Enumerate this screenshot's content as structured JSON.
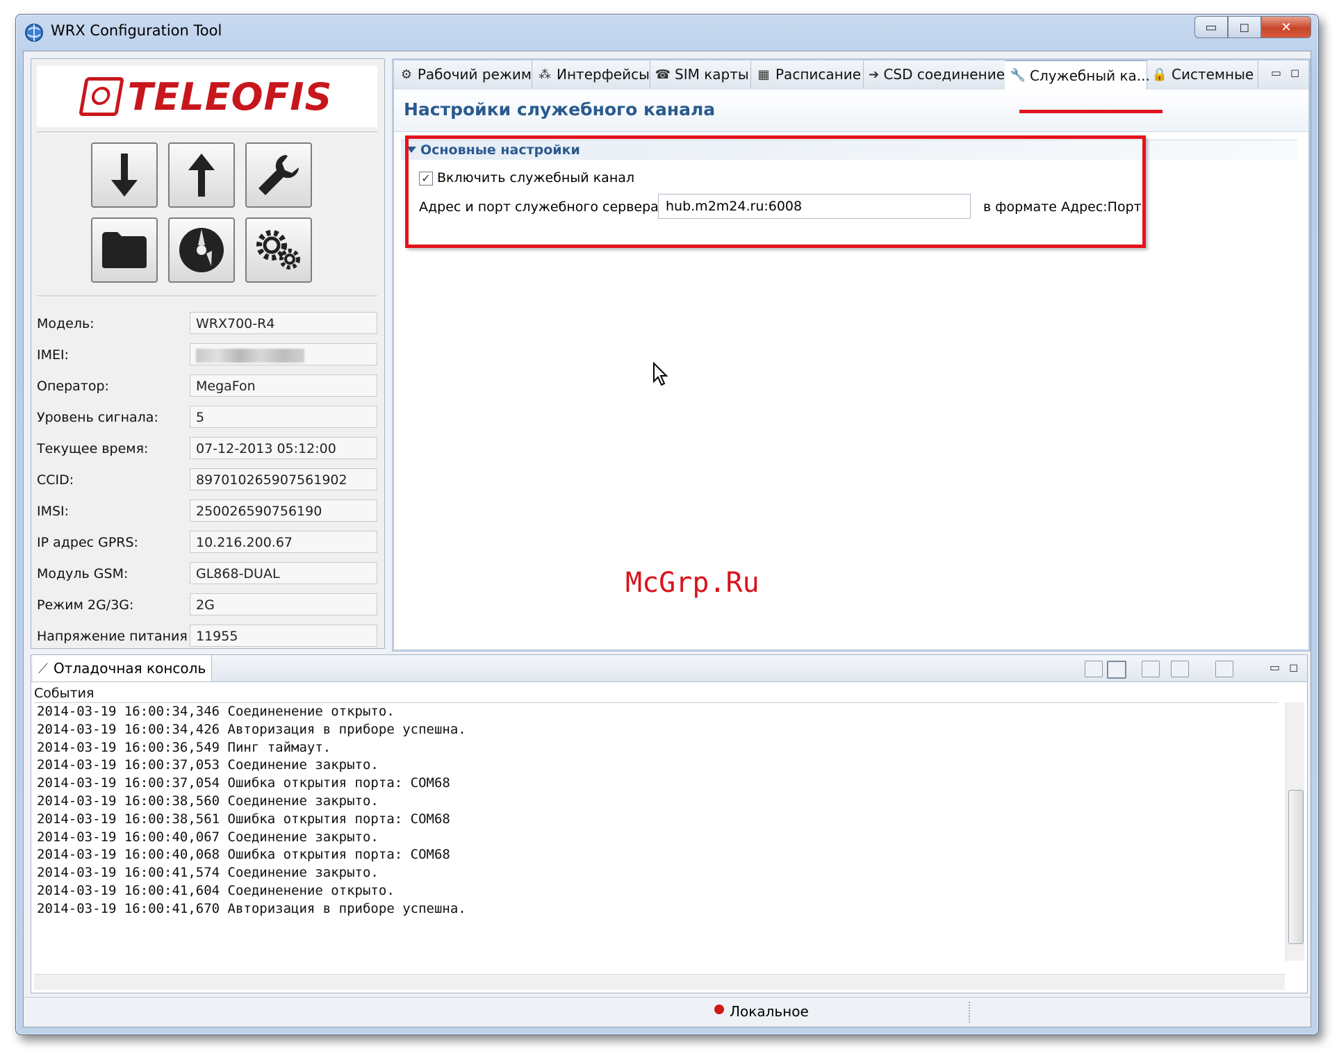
{
  "window": {
    "title": "WRX Configuration Tool",
    "controls": {
      "minimize": "▭",
      "maximize": "◻",
      "close": "✕"
    }
  },
  "left_panel": {
    "logo_text": "TELEOFIS",
    "toolbar_icons": [
      "arrow-down-icon",
      "arrow-up-icon",
      "wrench-icon",
      "folder-icon",
      "disc-icon",
      "gears-icon"
    ],
    "info": [
      {
        "label": "Модель:",
        "value": "WRX700-R4"
      },
      {
        "label": "IMEI:",
        "value": ""
      },
      {
        "label": "Оператор:",
        "value": "MegaFon"
      },
      {
        "label": "Уровень сигнала:",
        "value": "5"
      },
      {
        "label": "Текущее время:",
        "value": "07-12-2013 05:12:00"
      },
      {
        "label": "CCID:",
        "value": "897010265907561902"
      },
      {
        "label": "IMSI:",
        "value": "250026590756190"
      },
      {
        "label": "IP адрес GPRS:",
        "value": "10.216.200.67"
      },
      {
        "label": "Модуль GSM:",
        "value": "GL868-DUAL"
      },
      {
        "label": "Режим 2G/3G:",
        "value": "2G"
      },
      {
        "label": "Напряжение питания",
        "value": "11955"
      }
    ]
  },
  "editor": {
    "tabs": [
      {
        "label": "Рабочий режим",
        "icon": "gear-dot-icon"
      },
      {
        "label": "Интерфейсы",
        "icon": "interfaces-icon"
      },
      {
        "label": "SIM карты",
        "icon": "phone-icon"
      },
      {
        "label": "Расписание",
        "icon": "schedule-icon"
      },
      {
        "label": "CSD соединение",
        "icon": "arrow-right-icon"
      },
      {
        "label": "Служебный ка...",
        "icon": "wrench-icon"
      },
      {
        "label": "Системные",
        "icon": "lock-icon"
      }
    ],
    "active_tab": 5,
    "page_title": "Настройки служебного канала",
    "section_title": "Основные настройки",
    "enable_label": "Включить служебный канал",
    "enable_checked": true,
    "address_label": "Адрес и порт служебного сервера",
    "address_value": "hub.m2m24.ru:6008",
    "address_hint": "в формате Адрес:Порт",
    "highlight_color": "#e3141d"
  },
  "watermark": "McGrp.Ru",
  "console": {
    "tab_label": "Отладочная консоль",
    "events_label": "События",
    "lines": [
      "2014-03-19 16:00:34,346 Соединенение открыто.",
      "2014-03-19 16:00:34,426 Авторизация в приборе успешна.",
      "2014-03-19 16:00:36,549 Пинг таймаут.",
      "2014-03-19 16:00:37,053 Соединение закрыто.",
      "2014-03-19 16:00:37,054 Ошибка открытия порта: COM68",
      "2014-03-19 16:00:38,560 Соединение закрыто.",
      "2014-03-19 16:00:38,561 Ошибка открытия порта: COM68",
      "2014-03-19 16:00:40,067 Соединение закрыто.",
      "2014-03-19 16:00:40,068 Ошибка открытия порта: COM68",
      "2014-03-19 16:00:41,574 Соединение закрыто.",
      "2014-03-19 16:00:41,604 Соединенение открыто.",
      "2014-03-19 16:00:41,670 Авторизация в приборе успешна."
    ]
  },
  "status": {
    "text": "Локальное"
  }
}
